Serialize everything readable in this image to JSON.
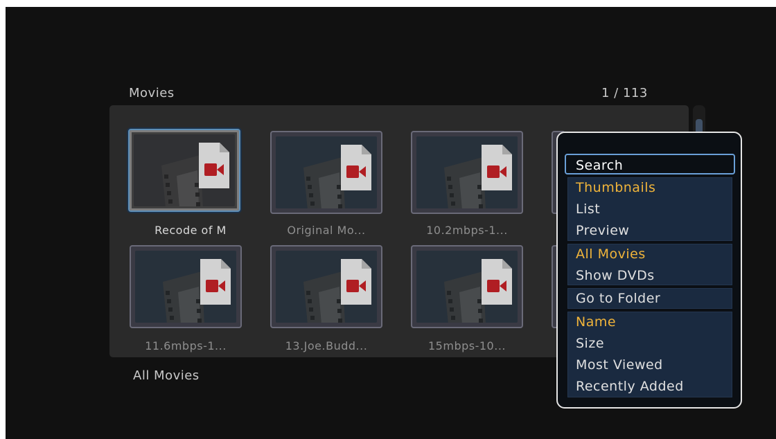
{
  "header": {
    "title": "Movies",
    "page_counter": "1 / 113"
  },
  "grid": {
    "items": [
      {
        "label": "Recode of M",
        "selected": true
      },
      {
        "label": "Original Mo..."
      },
      {
        "label": "10.2mbps-1..."
      },
      {
        "label": "11.6mbps-1..."
      },
      {
        "label": "13.Joe.Budd..."
      },
      {
        "label": "15mbps-10..."
      }
    ]
  },
  "footer": {
    "filter_label": "All Movies"
  },
  "menu": {
    "search": "Search",
    "view_items": [
      "Thumbnails",
      "List",
      "Preview"
    ],
    "filter_items": [
      "All Movies",
      "Show DVDs"
    ],
    "folder_item": "Go to Folder",
    "sort_items": [
      "Name",
      "Size",
      "Most Viewed",
      "Recently Added"
    ],
    "active_view": "Thumbnails",
    "active_filter": "All Movies",
    "active_sort": "Name"
  },
  "colors": {
    "accent": "#f0b43a",
    "focus": "#6aa0d8",
    "icon_red": "#b01e23"
  },
  "icons": {
    "thumbnail": "video-file-icon"
  }
}
